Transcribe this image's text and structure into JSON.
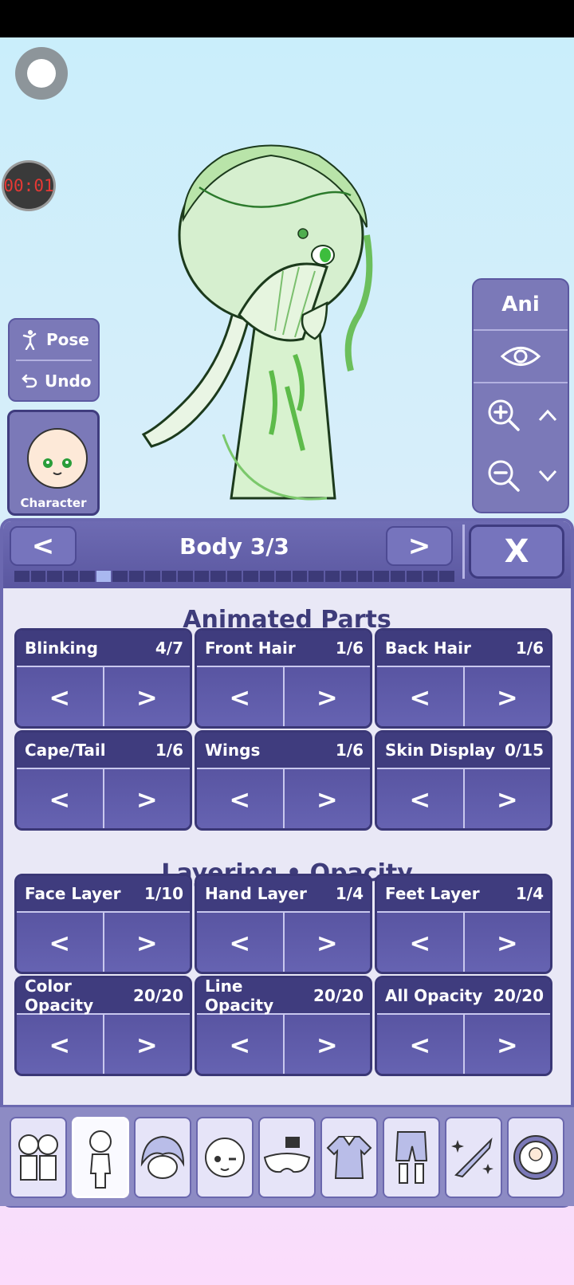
{
  "recorder": {
    "timer": "00:01"
  },
  "left_panel": {
    "pose_label": "Pose",
    "undo_label": "Undo",
    "character_label": "Character"
  },
  "right_panel": {
    "ani_label": "Ani"
  },
  "header": {
    "title": "Body 3/3",
    "prev_label": "<",
    "next_label": ">",
    "close_label": "X",
    "progress": {
      "total": 27,
      "current": 6
    }
  },
  "sections": {
    "animated": "Animated Parts",
    "layering": "Layering • Opacity"
  },
  "cards": [
    {
      "label": "Blinking",
      "value": "4/7"
    },
    {
      "label": "Front Hair",
      "value": "1/6"
    },
    {
      "label": "Back Hair",
      "value": "1/6"
    },
    {
      "label": "Cape/Tail",
      "value": "1/6"
    },
    {
      "label": "Wings",
      "value": "1/6"
    },
    {
      "label": "Skin Display",
      "value": "0/15"
    },
    {
      "label": "Face Layer",
      "value": "1/10"
    },
    {
      "label": "Hand Layer",
      "value": "1/4"
    },
    {
      "label": "Feet Layer",
      "value": "1/4"
    },
    {
      "label": "Color Opacity",
      "value": "20/20"
    },
    {
      "label": "Line Opacity",
      "value": "20/20"
    },
    {
      "label": "All Opacity",
      "value": "20/20"
    }
  ],
  "arrows": {
    "left": "<",
    "right": ">"
  },
  "tabs": [
    "characters-tab",
    "body-tab",
    "hair-tab",
    "face-tab",
    "accessory-tab",
    "top-clothing-tab",
    "bottom-clothing-tab",
    "items-tab",
    "profile-tab"
  ],
  "colors": {
    "panel": "#6b68b0",
    "accent": "#3f3c7e",
    "timer_text": "#e53935"
  }
}
